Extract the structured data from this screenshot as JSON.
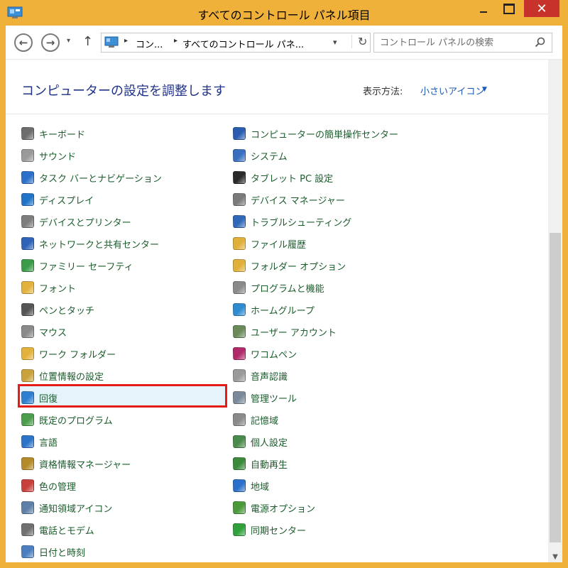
{
  "window": {
    "title": "すべてのコントロール パネル項目",
    "close_glyph": "✕"
  },
  "nav": {
    "back": "←",
    "forward": "→",
    "history": "▾",
    "up": "↑"
  },
  "address": {
    "crumb_sep": "▸",
    "crumb1": "コン...",
    "crumb2": "すべてのコントロール パネ...",
    "dropdown": "▾",
    "refresh": "↻"
  },
  "search": {
    "placeholder": "コントロール パネルの検索"
  },
  "content": {
    "heading": "コンピューターの設定を調整します",
    "view_by_label": "表示方法:",
    "view_by_value": "小さいアイコン",
    "view_caret": "▼"
  },
  "items_left": [
    {
      "label": "キーボード",
      "icon": "keyboard-icon"
    },
    {
      "label": "サウンド",
      "icon": "speaker-icon"
    },
    {
      "label": "タスク バーとナビゲーション",
      "icon": "taskbar-icon"
    },
    {
      "label": "ディスプレイ",
      "icon": "monitor-icon"
    },
    {
      "label": "デバイスとプリンター",
      "icon": "printer-icon"
    },
    {
      "label": "ネットワークと共有センター",
      "icon": "network-icon"
    },
    {
      "label": "ファミリー セーフティ",
      "icon": "family-icon"
    },
    {
      "label": "フォント",
      "icon": "font-folder-icon"
    },
    {
      "label": "ペンとタッチ",
      "icon": "pen-icon"
    },
    {
      "label": "マウス",
      "icon": "mouse-icon"
    },
    {
      "label": "ワーク フォルダー",
      "icon": "work-folder-icon"
    },
    {
      "label": "位置情報の設定",
      "icon": "location-icon"
    },
    {
      "label": "回復",
      "icon": "recovery-icon"
    },
    {
      "label": "既定のプログラム",
      "icon": "default-programs-icon"
    },
    {
      "label": "言語",
      "icon": "language-icon"
    },
    {
      "label": "資格情報マネージャー",
      "icon": "credential-icon"
    },
    {
      "label": "色の管理",
      "icon": "color-icon"
    },
    {
      "label": "通知領域アイコン",
      "icon": "notification-icon"
    },
    {
      "label": "電話とモデム",
      "icon": "phone-icon"
    },
    {
      "label": "日付と時刻",
      "icon": "clock-icon"
    }
  ],
  "items_right": [
    {
      "label": "コンピューターの簡単操作センター",
      "icon": "accessibility-icon"
    },
    {
      "label": "システム",
      "icon": "system-icon"
    },
    {
      "label": "タブレット PC 設定",
      "icon": "tablet-icon"
    },
    {
      "label": "デバイス マネージャー",
      "icon": "device-manager-icon"
    },
    {
      "label": "トラブルシューティング",
      "icon": "troubleshoot-icon"
    },
    {
      "label": "ファイル履歴",
      "icon": "file-history-icon"
    },
    {
      "label": "フォルダー オプション",
      "icon": "folder-options-icon"
    },
    {
      "label": "プログラムと機能",
      "icon": "programs-icon"
    },
    {
      "label": "ホームグループ",
      "icon": "homegroup-icon"
    },
    {
      "label": "ユーザー アカウント",
      "icon": "user-accounts-icon"
    },
    {
      "label": "ワコムペン",
      "icon": "wacom-icon"
    },
    {
      "label": "音声認識",
      "icon": "microphone-icon"
    },
    {
      "label": "管理ツール",
      "icon": "admin-tools-icon"
    },
    {
      "label": "記憶域",
      "icon": "storage-icon"
    },
    {
      "label": "個人設定",
      "icon": "personalization-icon"
    },
    {
      "label": "自動再生",
      "icon": "autoplay-icon"
    },
    {
      "label": "地域",
      "icon": "region-icon"
    },
    {
      "label": "電源オプション",
      "icon": "power-icon"
    },
    {
      "label": "同期センター",
      "icon": "sync-icon"
    }
  ],
  "highlighted_item": "回復",
  "colors": {
    "frame": "#f0b13a",
    "close_button": "#c7322a",
    "heading": "#1e3287",
    "item_text": "#1a5c2b",
    "link": "#1e5ab4",
    "highlight_border": "#e41b17"
  }
}
